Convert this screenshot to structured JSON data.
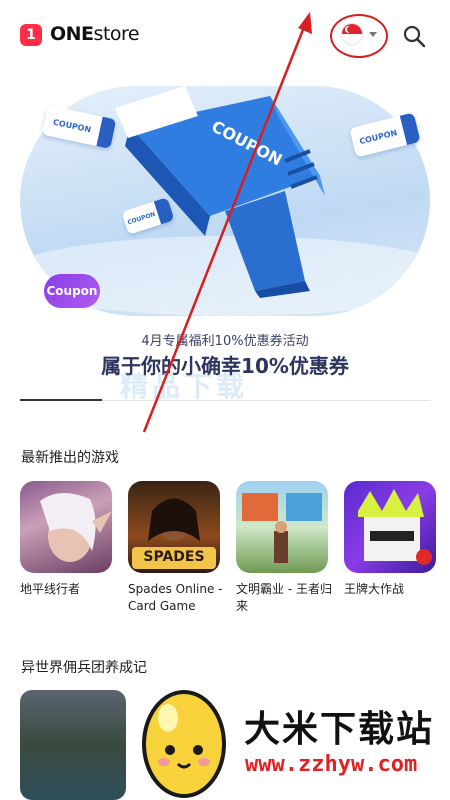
{
  "header": {
    "logo_badge": "1",
    "logo_bold": "ONE",
    "logo_light": "store",
    "country": "Singapore",
    "icons": [
      "search-icon",
      "chevron-down-icon",
      "flag-icon"
    ]
  },
  "banner": {
    "coupon_text": "COUPON",
    "coupon_pill": "Coupon",
    "subtitle": "4月专属福利10%优惠券活动",
    "title": "属于你的小确幸10%优惠券"
  },
  "watermark": "精品下载",
  "section_new_games": {
    "title": "最新推出的游戏",
    "games": [
      {
        "name": "地平线行者"
      },
      {
        "name": "Spades Online - Card Game",
        "thumb_label": "SPADES"
      },
      {
        "name": "文明霸业 - 王者归来"
      },
      {
        "name": "王牌大作战"
      }
    ]
  },
  "section_second": {
    "title": "异世界佣兵团养成记"
  },
  "overlay": {
    "site_name": "大米下载站",
    "site_url": "www.zzhyw.com"
  },
  "colors": {
    "brand_red": "#ff2d46",
    "annotation_red": "#d81e1e",
    "banner_blue": "#bfd9f3",
    "coupon_purple": "#8a3de8"
  }
}
